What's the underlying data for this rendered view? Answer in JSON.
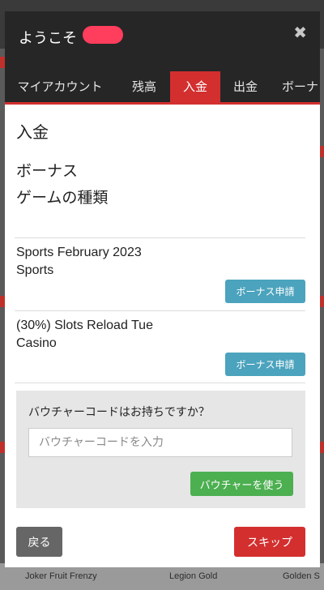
{
  "modal": {
    "title": "ようこそ",
    "tabs": [
      {
        "label": "マイアカウント",
        "active": false
      },
      {
        "label": "残高",
        "active": false
      },
      {
        "label": "入金",
        "active": true
      },
      {
        "label": "出金",
        "active": false
      },
      {
        "label": "ボーナ",
        "active": false
      }
    ],
    "section_title": "入金",
    "bonus_label": "ボーナス",
    "game_type_label": "ゲームの種類",
    "bonuses": [
      {
        "name": "Sports February 2023",
        "type": "Sports",
        "button_label": "ボーナス申請"
      },
      {
        "name": "(30%) Slots Reload Tue",
        "type": "Casino",
        "button_label": "ボーナス申請"
      }
    ],
    "voucher": {
      "question": "バウチャーコードはお持ちですか？",
      "placeholder": "バウチャーコードを入力",
      "button_label": "バウチャーを使う"
    },
    "back_label": "戻る",
    "skip_label": "スキップ"
  },
  "background_games": [
    "Joker Fruit Frenzy",
    "Legion Gold",
    "Golden S"
  ],
  "colors": {
    "header_bg": "#262626",
    "accent_red": "#d32f2f",
    "info_blue": "#4ba3bd",
    "success_green": "#4caf50",
    "back_gray": "#666666",
    "voucher_panel_bg": "#e6e6e6"
  }
}
